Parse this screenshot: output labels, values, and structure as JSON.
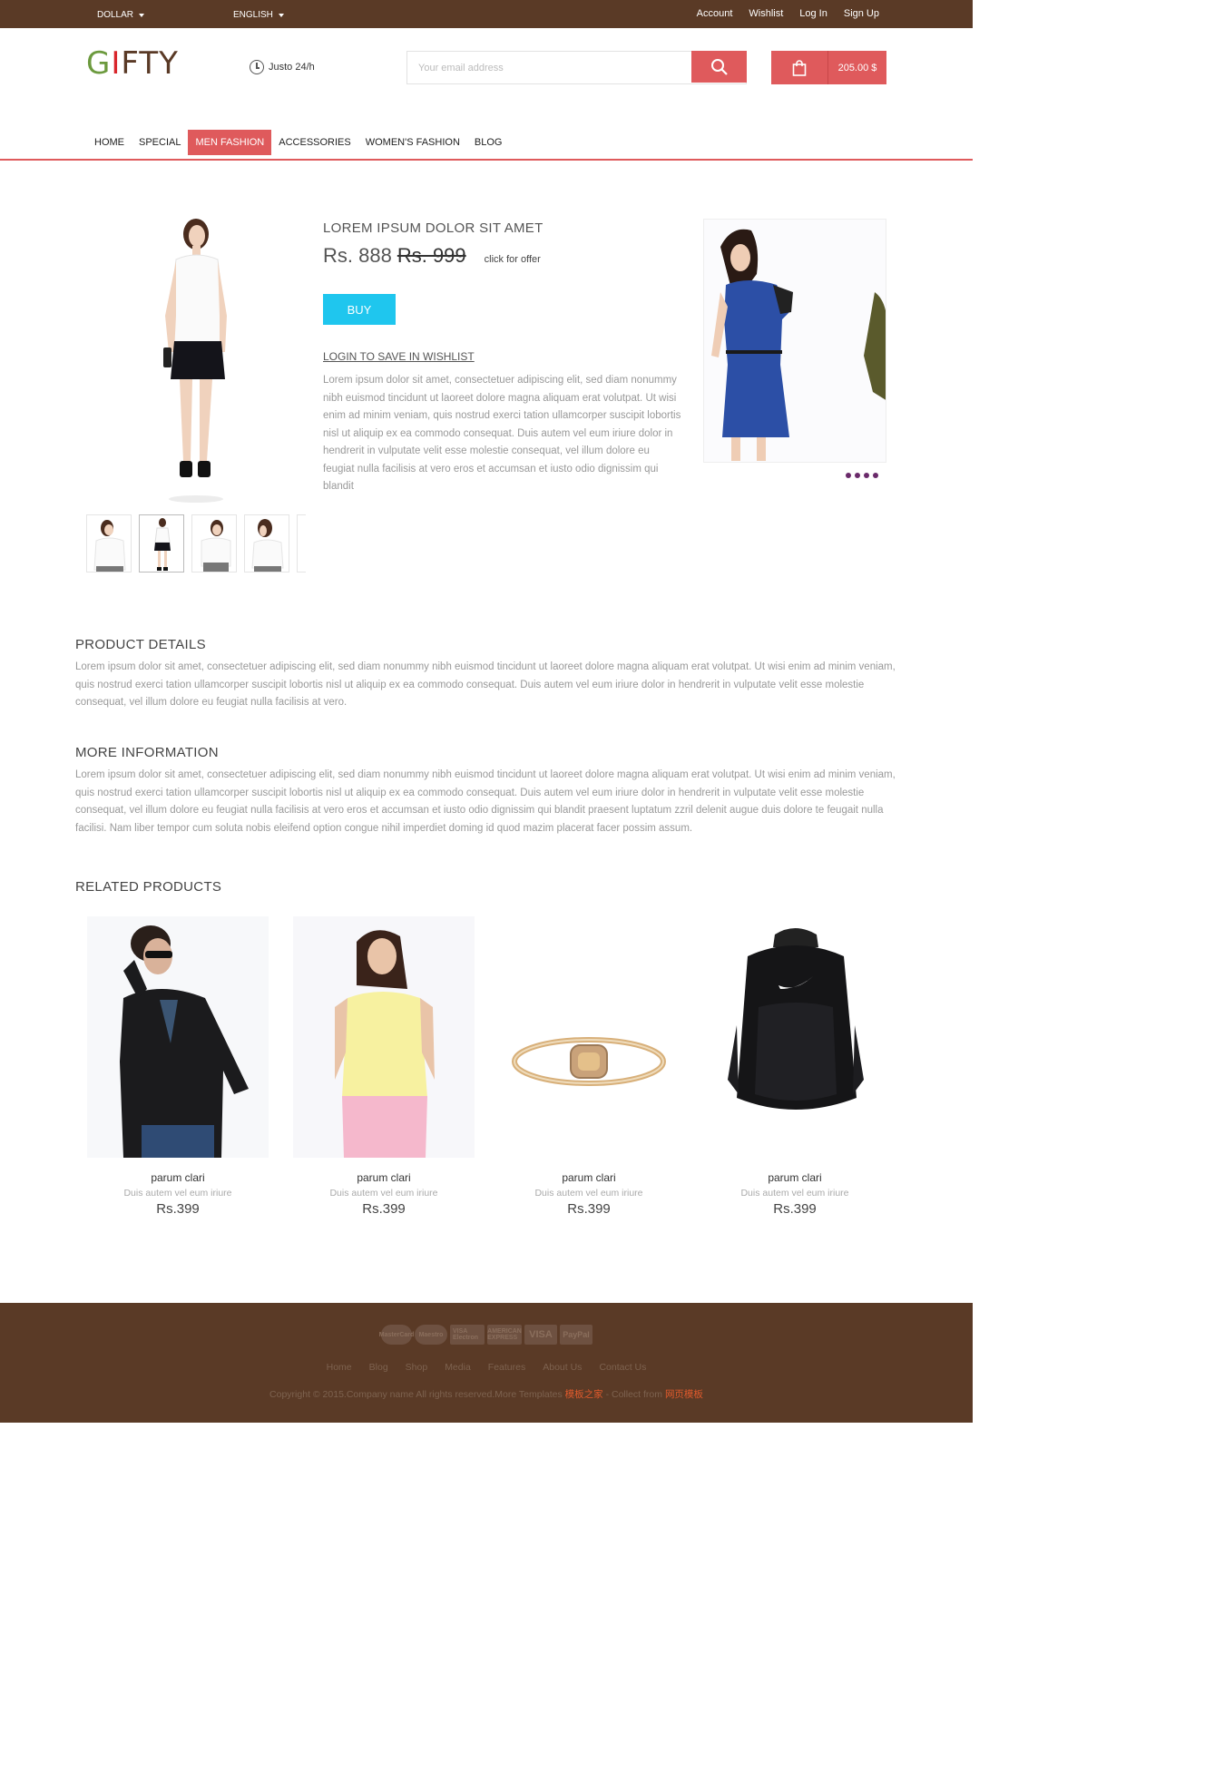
{
  "topbar": {
    "currency": "DOLLAR",
    "language": "ENGLISH",
    "links": [
      "Account",
      "Wishlist",
      "Log In",
      "Sign Up"
    ]
  },
  "header": {
    "logo": {
      "g": "G",
      "i": "I",
      "rest": "FTY"
    },
    "hours": "Justo 24/h",
    "search_placeholder": "Your email address",
    "cart_total": "205.00 $"
  },
  "nav": {
    "items": [
      "HOME",
      "SPECIAL",
      "MEN FASHION",
      "ACCESSORIES",
      "WOMEN'S FASHION",
      "BLOG"
    ],
    "active": "MEN FASHION"
  },
  "product": {
    "title": "LOREM IPSUM DOLOR SIT AMET",
    "price_now": "Rs. 888",
    "price_old": "Rs. 999",
    "offer": "click for offer",
    "buy": "BUY",
    "wishlist": "LOGIN TO SAVE IN WISHLIST",
    "description": "Lorem ipsum dolor sit amet, consectetuer adipiscing elit, sed diam nonummy nibh euismod tincidunt ut laoreet dolore magna aliquam erat volutpat. Ut wisi enim ad minim veniam, quis nostrud exerci tation ullamcorper suscipit lobortis nisl ut aliquip ex ea commodo consequat. Duis autem vel eum iriure dolor in hendrerit in vulputate velit esse molestie consequat, vel illum dolore eu feugiat nulla facilisis at vero eros et accumsan et iusto odio dignissim qui blandit"
  },
  "details": {
    "title": "PRODUCT DETAILS",
    "text": "Lorem ipsum dolor sit amet, consectetuer adipiscing elit, sed diam nonummy nibh euismod tincidunt ut laoreet dolore magna aliquam erat volutpat. Ut wisi enim ad minim veniam, quis nostrud exerci tation ullamcorper suscipit lobortis nisl ut aliquip ex ea commodo consequat. Duis autem vel eum iriure dolor in hendrerit in vulputate velit esse molestie consequat, vel illum dolore eu feugiat nulla facilisis at vero."
  },
  "more": {
    "title": "MORE INFORMATION",
    "text": "Lorem ipsum dolor sit amet, consectetuer adipiscing elit, sed diam nonummy nibh euismod tincidunt ut laoreet dolore magna aliquam erat volutpat. Ut wisi enim ad minim veniam, quis nostrud exerci tation ullamcorper suscipit lobortis nisl ut aliquip ex ea commodo consequat. Duis autem vel eum iriure dolor in hendrerit in vulputate velit esse molestie consequat, vel illum dolore eu feugiat nulla facilisis at vero eros et accumsan et iusto odio dignissim qui blandit praesent luptatum zzril delenit augue duis dolore te feugait nulla facilisi. Nam liber tempor cum soluta nobis eleifend option congue nihil imperdiet doming id quod mazim placerat facer possim assum."
  },
  "related": {
    "title": "RELATED PRODUCTS",
    "items": [
      {
        "name": "parum clari",
        "sub": "Duis autem vel eum iriure",
        "price": "Rs.399"
      },
      {
        "name": "parum clari",
        "sub": "Duis autem vel eum iriure",
        "price": "Rs.399"
      },
      {
        "name": "parum clari",
        "sub": "Duis autem vel eum iriure",
        "price": "Rs.399"
      },
      {
        "name": "parum clari",
        "sub": "Duis autem vel eum iriure",
        "price": "Rs.399"
      }
    ]
  },
  "footer": {
    "cards": [
      "MasterCard",
      "Maestro",
      "VISA Electron",
      "AMERICAN EXPRESS",
      "VISA",
      "PayPal"
    ],
    "links": [
      "Home",
      "Blog",
      "Shop",
      "Media",
      "Features",
      "About Us",
      "Contact Us"
    ],
    "copyright": "Copyright © 2015.Company name All rights reserved.More Templates ",
    "copy_hl1": "模板之家",
    "copy_mid": " - Collect from ",
    "copy_hl2": "网页模板"
  },
  "colors": {
    "brand_brown": "#5a3a26",
    "accent_red": "#df5a5c",
    "buy_cyan": "#1fc6ee"
  }
}
